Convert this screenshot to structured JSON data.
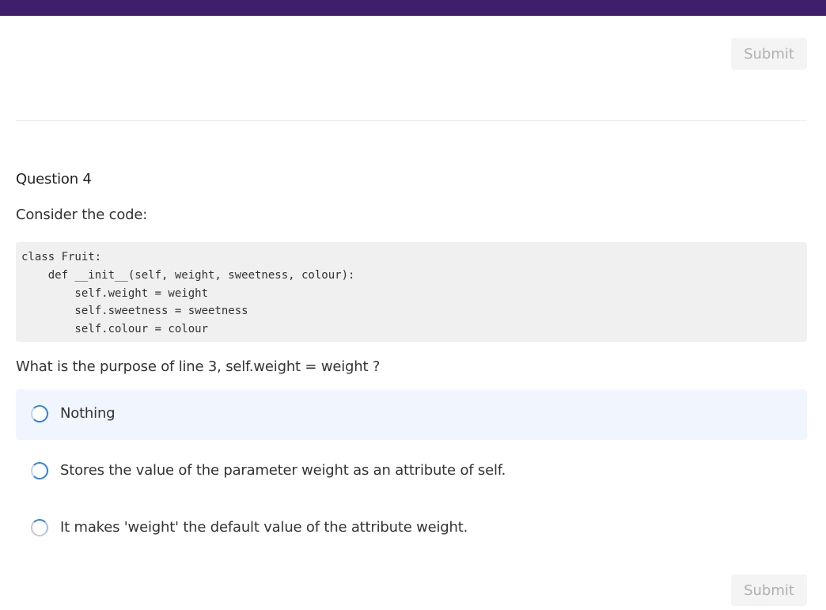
{
  "header": {
    "bar_color": "#3f1e6b"
  },
  "submit_label": "Submit",
  "question": {
    "title": "Question 4",
    "intro": "Consider the code:",
    "code_lines": [
      "class Fruit:",
      "    def __init__(self, weight, sweetness, colour):",
      "        self.weight = weight",
      "        self.sweetness = sweetness",
      "        self.colour = colour"
    ],
    "prompt": "What is the purpose of line 3, self.weight = weight ?",
    "options": [
      {
        "label": "Nothing",
        "selected": false,
        "highlighted": true
      },
      {
        "label": "Stores the value of the parameter weight as an attribute of self.",
        "selected": false,
        "highlighted": false
      },
      {
        "label": "It makes 'weight' the default value of the attribute weight.",
        "selected": false,
        "highlighted": false
      }
    ]
  },
  "colors": {
    "accent": "#2f7fe6",
    "option_highlight": "#f1f6fe",
    "code_background": "#f0f0f0"
  },
  "icons": {
    "radio": "radio-button-unchecked-icon"
  }
}
